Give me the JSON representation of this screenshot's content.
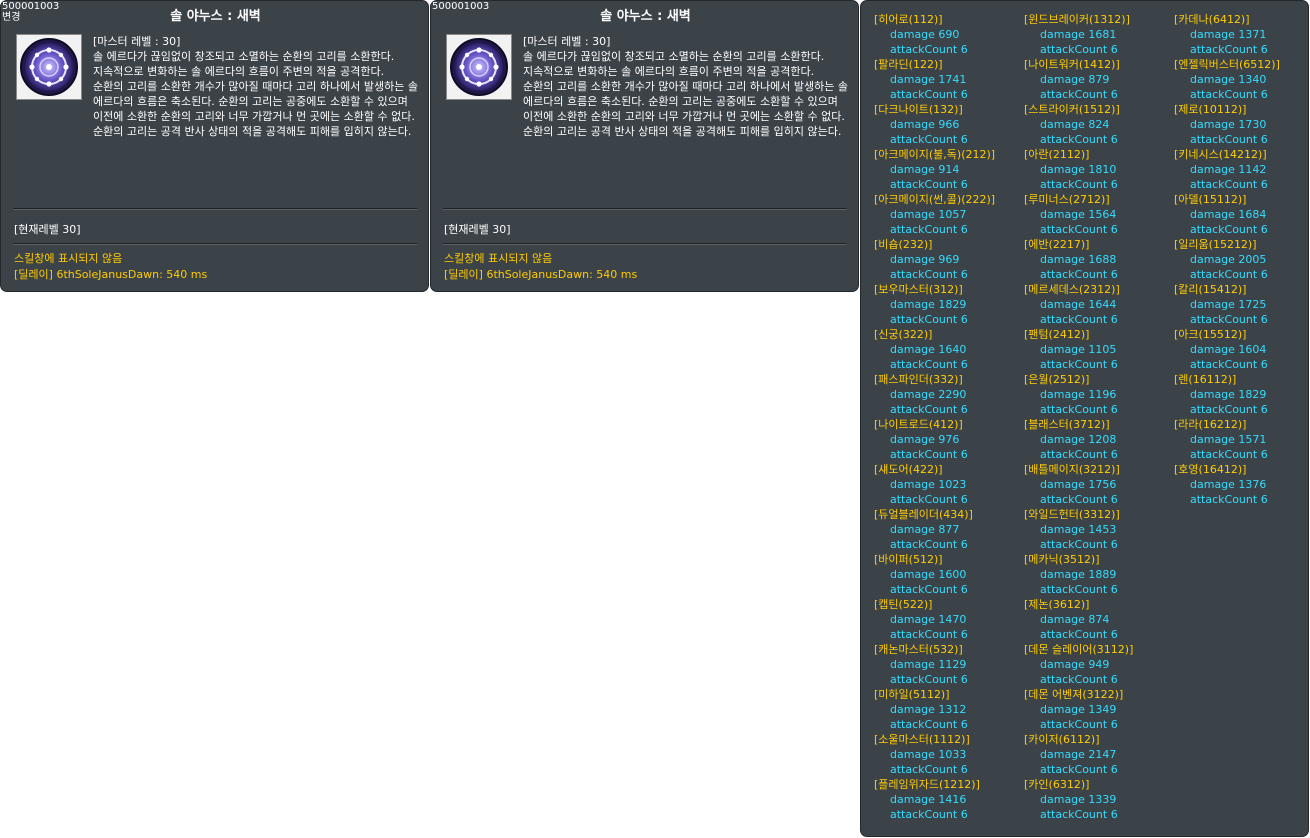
{
  "tooltips": [
    {
      "skill_id": "500001003",
      "change_label": "변경",
      "title": "솔 야누스 : 새벽",
      "master_level": "[마스터 레벨 : 30]",
      "description": [
        "솔 에르다가 끊임없이 창조되고 소멸하는 순환의 고리를 소환한다. 지속적으로 변화하는 솔 에르다의 흐름이 주변의 적을 공격한다.",
        "순환의 고리를 소환한 개수가 많아질 때마다 고리 하나에서 발생하는 솔 에르다의 흐름은 축소된다. 순환의 고리는 공중에도 소환할 수 있으며 이전에 소환한 순환의 고리와 너무 가깝거나 먼 곳에는 소환할 수 없다.",
        "순환의 고리는 공격 반사 상태의 적을 공격해도 피해를 입히지 않는다."
      ],
      "current_level": "[현재레벨 30]",
      "hidden_note": "스킬창에 표시되지 않음",
      "delay": "[딜레이] 6thSoleJanusDawn: 540 ms"
    },
    {
      "skill_id": "500001003",
      "title": "솔 야누스 : 새벽",
      "master_level": "[마스터 레벨 : 30]",
      "description": [
        "솔 에르다가 끊임없이 창조되고 소멸하는 순환의 고리를 소환한다. 지속적으로 변화하는 솔 에르다의 흐름이 주변의 적을 공격한다.",
        "순환의 고리를 소환한 개수가 많아질 때마다 고리 하나에서 발생하는 솔 에르다의 흐름은 축소된다. 순환의 고리는 공중에도 소환할 수 있으며 이전에 소환한 순환의 고리와 너무 가깝거나 먼 곳에는 소환할 수 없다.",
        "순환의 고리는 공격 반사 상태의 적을 공격해도 피해를 입히지 않는다."
      ],
      "current_level": "[현재레벨 30]",
      "hidden_note": "스킬창에 표시되지 않음",
      "delay": "[딜레이] 6thSoleJanusDawn: 540 ms"
    }
  ],
  "stats_columns": [
    [
      {
        "job": "[히어로(112)]",
        "damage": "damage 690",
        "count": "attackCount 6"
      },
      {
        "job": "[팔라딘(122)]",
        "damage": "damage 1741",
        "count": "attackCount 6"
      },
      {
        "job": "[다크나이트(132)]",
        "damage": "damage 966",
        "count": "attackCount 6"
      },
      {
        "job": "[아크메이지(불,독)(212)]",
        "damage": "damage 914",
        "count": "attackCount 6"
      },
      {
        "job": "[아크메이지(썬,콜)(222)]",
        "damage": "damage 1057",
        "count": "attackCount 6"
      },
      {
        "job": "[비숍(232)]",
        "damage": "damage 969",
        "count": "attackCount 6"
      },
      {
        "job": "[보우마스터(312)]",
        "damage": "damage 1829",
        "count": "attackCount 6"
      },
      {
        "job": "[신궁(322)]",
        "damage": "damage 1640",
        "count": "attackCount 6"
      },
      {
        "job": "[패스파인더(332)]",
        "damage": "damage 2290",
        "count": "attackCount 6"
      },
      {
        "job": "[나이트로드(412)]",
        "damage": "damage 976",
        "count": "attackCount 6"
      },
      {
        "job": "[섀도어(422)]",
        "damage": "damage 1023",
        "count": "attackCount 6"
      },
      {
        "job": "[듀얼블레이더(434)]",
        "damage": "damage 877",
        "count": "attackCount 6"
      },
      {
        "job": "[바이퍼(512)]",
        "damage": "damage 1600",
        "count": "attackCount 6"
      },
      {
        "job": "[캡틴(522)]",
        "damage": "damage 1470",
        "count": "attackCount 6"
      },
      {
        "job": "[캐논마스터(532)]",
        "damage": "damage 1129",
        "count": "attackCount 6"
      },
      {
        "job": "[미하일(5112)]",
        "damage": "damage 1312",
        "count": "attackCount 6"
      },
      {
        "job": "[소울마스터(1112)]",
        "damage": "damage 1033",
        "count": "attackCount 6"
      },
      {
        "job": "[플레임위자드(1212)]",
        "damage": "damage 1416",
        "count": "attackCount 6"
      }
    ],
    [
      {
        "job": "[윈드브레이커(1312)]",
        "damage": "damage 1681",
        "count": "attackCount 6"
      },
      {
        "job": "[나이트워커(1412)]",
        "damage": "damage 879",
        "count": "attackCount 6"
      },
      {
        "job": "[스트라이커(1512)]",
        "damage": "damage 824",
        "count": "attackCount 6"
      },
      {
        "job": "[아란(2112)]",
        "damage": "damage 1810",
        "count": "attackCount 6"
      },
      {
        "job": "[루미너스(2712)]",
        "damage": "damage 1564",
        "count": "attackCount 6"
      },
      {
        "job": "[에반(2217)]",
        "damage": "damage 1688",
        "count": "attackCount 6"
      },
      {
        "job": "[메르세데스(2312)]",
        "damage": "damage 1644",
        "count": "attackCount 6"
      },
      {
        "job": "[팬텀(2412)]",
        "damage": "damage 1105",
        "count": "attackCount 6"
      },
      {
        "job": "[은월(2512)]",
        "damage": "damage 1196",
        "count": "attackCount 6"
      },
      {
        "job": "[블래스터(3712)]",
        "damage": "damage 1208",
        "count": "attackCount 6"
      },
      {
        "job": "[배틀메이지(3212)]",
        "damage": "damage 1756",
        "count": "attackCount 6"
      },
      {
        "job": "[와일드헌터(3312)]",
        "damage": "damage 1453",
        "count": "attackCount 6"
      },
      {
        "job": "[메카닉(3512)]",
        "damage": "damage 1889",
        "count": "attackCount 6"
      },
      {
        "job": "[제논(3612)]",
        "damage": "damage 874",
        "count": "attackCount 6"
      },
      {
        "job": "[데몬 슬레이어(3112)]",
        "damage": "damage 949",
        "count": "attackCount 6"
      },
      {
        "job": "[데몬 어벤져(3122)]",
        "damage": "damage 1349",
        "count": "attackCount 6"
      },
      {
        "job": "[카이저(6112)]",
        "damage": "damage 2147",
        "count": "attackCount 6"
      },
      {
        "job": "[카인(6312)]",
        "damage": "damage 1339",
        "count": "attackCount 6"
      }
    ],
    [
      {
        "job": "[카데나(6412)]",
        "damage": "damage 1371",
        "count": "attackCount 6"
      },
      {
        "job": "[엔젤릭버스터(6512)]",
        "damage": "damage 1340",
        "count": "attackCount 6"
      },
      {
        "job": "[제로(10112)]",
        "damage": "damage 1730",
        "count": "attackCount 6"
      },
      {
        "job": "[키네시스(14212)]",
        "damage": "damage 1142",
        "count": "attackCount 6"
      },
      {
        "job": "[아델(15112)]",
        "damage": "damage 1684",
        "count": "attackCount 6"
      },
      {
        "job": "[일리움(15212)]",
        "damage": "damage 2005",
        "count": "attackCount 6"
      },
      {
        "job": "[칼리(15412)]",
        "damage": "damage 1725",
        "count": "attackCount 6"
      },
      {
        "job": "[아크(15512)]",
        "damage": "damage 1604",
        "count": "attackCount 6"
      },
      {
        "job": "[렌(16112)]",
        "damage": "damage 1829",
        "count": "attackCount 6"
      },
      {
        "job": "[라라(16212)]",
        "damage": "damage 1571",
        "count": "attackCount 6"
      },
      {
        "job": "[호영(16412)]",
        "damage": "damage 1376",
        "count": "attackCount 6"
      }
    ]
  ],
  "colors": {
    "panel_bg": "#3b4248",
    "job_name": "#ffcc00",
    "stat_value": "#33ddff",
    "note": "#ffcc00"
  },
  "icons": {
    "skill": "sol-janus-dawn-icon"
  }
}
